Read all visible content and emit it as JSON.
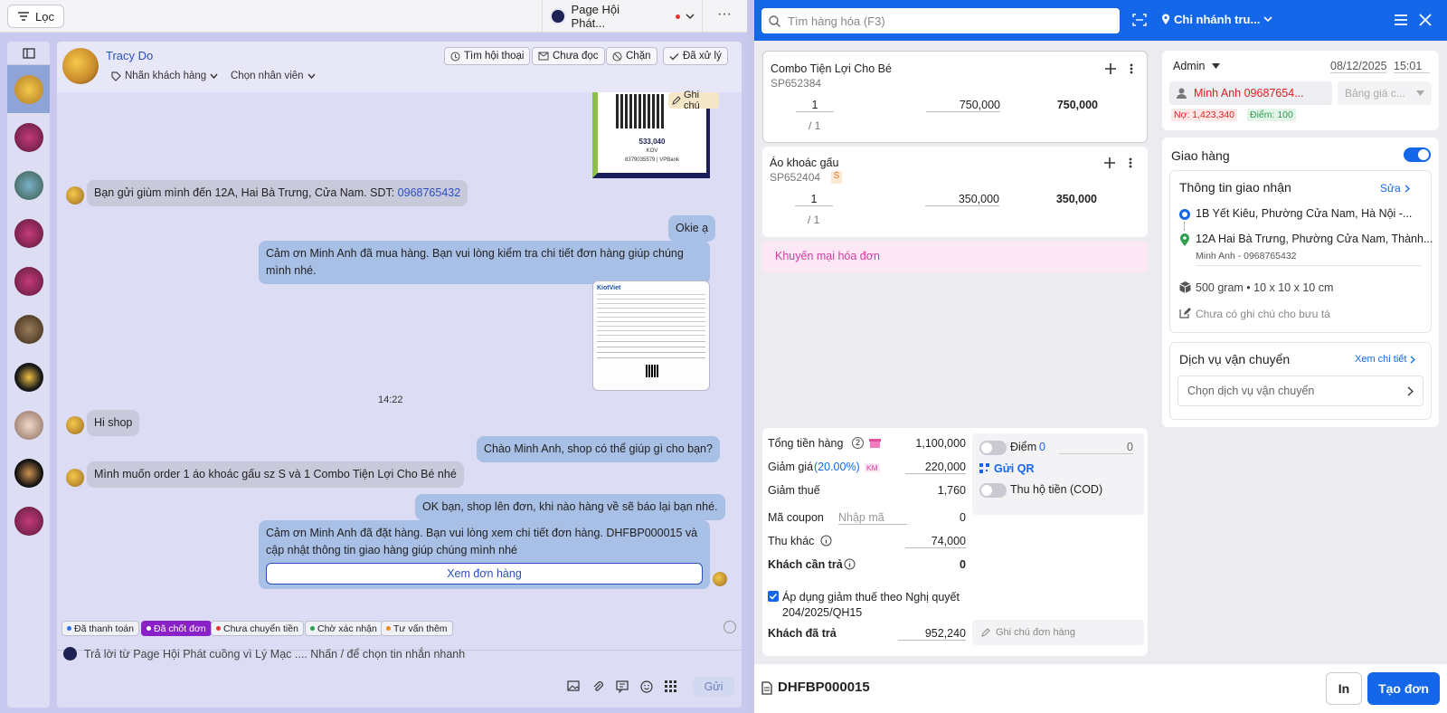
{
  "topbar": {
    "filter_label": "Lọc",
    "page_name": "Page Hội Phát...",
    "more": "···"
  },
  "chat": {
    "customer_name": "Tracy Do",
    "tag_select": "Nhãn khách hàng",
    "staff_select": "Chọn nhân viên",
    "buttons": {
      "find": "Tìm hội thoại",
      "unread": "Chưa đọc",
      "block": "Chặn",
      "done": "Đã xử lý"
    },
    "note_label": "Ghi chú",
    "qr": {
      "amount": "533,040",
      "account": "8379035579 | VPBank",
      "sub": "KOV"
    },
    "messages": {
      "m1_text": "Bạn gửi giùm mình đến 12A, Hai Bà Trưng, Cửa Nam. SDT: ",
      "m1_phone": "0968765432",
      "m2": "Okie ạ",
      "m3": "Cảm ơn Minh Anh đã mua hàng. Bạn vui lòng kiểm tra chi tiết đơn hàng giúp chúng mình nhé.",
      "time": "14:22",
      "m4": "Hi shop",
      "m5": "Chào Minh Anh, shop có thể giúp gì cho bạn?",
      "m6": "Mình muốn order 1 áo khoác gấu sz S và 1 Combo Tiện Lợi Cho Bé nhé",
      "m7": "OK bạn, shop lên đơn, khi nào hàng về sẽ báo lại bạn nhé.",
      "m8": "Cảm ơn Minh Anh đã đặt hàng. Bạn vui lòng xem chi tiết đơn hàng. DHFBP000015  và cập nhật thông tin giao hàng giúp chúng mình nhé",
      "m8_button": "Xem đơn hàng"
    },
    "tags": [
      "Đã thanh toán",
      "Đã chốt đơn",
      "Chưa chuyển tiền",
      "Chờ xác nhận",
      "Tư vấn thêm"
    ],
    "tag_colors": [
      "#2f6ee8",
      "#ffffff",
      "#e53935",
      "#2e9e4f",
      "#f08a1c"
    ],
    "reply_placeholder": "Trả lời từ Page Hội Phát cuồng vì Lý Mạc .... Nhấn / để chọn tin nhắn nhanh",
    "send_label": "Gửi"
  },
  "pos": {
    "search_placeholder": "Tìm hàng hóa (F3)",
    "branch": "Chi nhánh tru...",
    "products": [
      {
        "name": "Combo Tiện Lợi Cho Bé",
        "code": "SP652384",
        "qty": "1",
        "stock": "/ 1",
        "price": "750,000",
        "total": "750,000"
      },
      {
        "name": "Áo khoác gấu",
        "code": "SP652404",
        "badge": "S",
        "qty": "1",
        "stock": "/ 1",
        "price": "350,000",
        "total": "350,000"
      }
    ],
    "promo": "Khuyến mại hóa đơn",
    "summary": {
      "subtotal_label": "Tổng tiền hàng",
      "subtotal_count": "2",
      "subtotal": "1,100,000",
      "discount_label": "Giảm giá",
      "discount_pct": "(20.00%)",
      "discount_badge": "KM",
      "discount": "220,000",
      "tax_label": "Giảm thuế",
      "tax": "1,760",
      "coupon_label": "Mã coupon",
      "coupon_placeholder": "Nhập mã",
      "coupon": "0",
      "other_label": "Thu khác",
      "other": "74,000",
      "need_label": "Khách cần trả",
      "need": "0",
      "apply_label": "Áp dụng giảm thuế theo Nghị quyết 204/2025/QH15",
      "paid_label": "Khách đã trả",
      "paid": "952,240"
    },
    "points_label": "Điểm",
    "points_value": "0",
    "points_input": "0",
    "qr_label": "Gửi QR",
    "cod_label": "Thu hộ tiền (COD)",
    "order_note": "Ghi chú đơn hàng",
    "order_code": "DHFBP000015",
    "print_label": "In",
    "create_label": "Tạo đơn"
  },
  "customer": {
    "staff": "Admin",
    "date": "08/12/2025",
    "time": "15:01",
    "name": "Minh Anh 09687654...",
    "price_list": "Bảng giá c...",
    "debt": "Nợ: 1,423,340",
    "points": "Điểm: 100"
  },
  "shipping": {
    "title": "Giao hàng",
    "info_title": "Thông tin giao nhận",
    "edit": "Sửa",
    "from": "1B Yết Kiêu, Phường Cửa Nam, Hà Nội -...",
    "to": "12A Hai Bà Trưng, Phường Cửa Nam, Thành...",
    "receiver": "Minh Anh - 0968765432",
    "package": "500 gram • 10 x 10 x 10 cm",
    "note": "Chưa có ghi chú cho bưu tá",
    "service_title": "Dịch vụ vận chuyển",
    "service_detail": "Xem chi tiết",
    "service_placeholder": "Chọn dịch vụ vận chuyển"
  },
  "colors": {
    "accent": "#1467e8",
    "danger": "#e02020",
    "promo": "#d43aa5"
  }
}
